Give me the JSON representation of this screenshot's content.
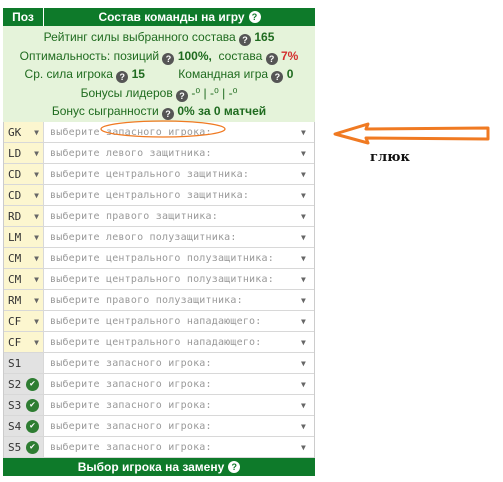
{
  "header": {
    "poz": "Поз",
    "title": "Состав команды на игру"
  },
  "stats": {
    "rating_label": "Рейтинг силы выбранного состава",
    "rating_value": "165",
    "optim_label": "Оптимальность: позиций",
    "optim_pos_value": "100%,",
    "optim_comp_label": "состава",
    "optim_comp_value": "7%",
    "avg_label": "Ср. сила игрока",
    "avg_value": "15",
    "team_label": "Командная игра",
    "team_value": "0",
    "leader_label": "Бонусы лидеров",
    "leader_value": "-⁰ | -⁰ | -⁰",
    "cohesion_label": "Бонус сыгранности",
    "cohesion_value": "0% за 0 матчей"
  },
  "rows": [
    {
      "pos": "GK",
      "placeholder": "выберите запасного игрока:",
      "type": "main"
    },
    {
      "pos": "LD",
      "placeholder": "выберите левого защитника:",
      "type": "main"
    },
    {
      "pos": "CD",
      "placeholder": "выберите центрального защитника:",
      "type": "main"
    },
    {
      "pos": "CD",
      "placeholder": "выберите центрального защитника:",
      "type": "main"
    },
    {
      "pos": "RD",
      "placeholder": "выберите правого защитника:",
      "type": "main"
    },
    {
      "pos": "LM",
      "placeholder": "выберите левого полузащитника:",
      "type": "main"
    },
    {
      "pos": "CM",
      "placeholder": "выберите центрального полузащитника:",
      "type": "main"
    },
    {
      "pos": "CM",
      "placeholder": "выберите центрального полузащитника:",
      "type": "main"
    },
    {
      "pos": "RM",
      "placeholder": "выберите правого полузащитника:",
      "type": "main"
    },
    {
      "pos": "CF",
      "placeholder": "выберите центрального нападающего:",
      "type": "main"
    },
    {
      "pos": "CF",
      "placeholder": "выберите центрального нападающего:",
      "type": "main"
    },
    {
      "pos": "S1",
      "placeholder": "выберите запасного игрока:",
      "type": "sub",
      "check": false
    },
    {
      "pos": "S2",
      "placeholder": "выберите запасного игрока:",
      "type": "sub",
      "check": true
    },
    {
      "pos": "S3",
      "placeholder": "выберите запасного игрока:",
      "type": "sub",
      "check": true
    },
    {
      "pos": "S4",
      "placeholder": "выберите запасного игрока:",
      "type": "sub",
      "check": true
    },
    {
      "pos": "S5",
      "placeholder": "выберите запасного игрока:",
      "type": "sub",
      "check": true
    }
  ],
  "footer": {
    "title": "Выбор игрока на замену"
  },
  "annotation": {
    "note": "глюк"
  },
  "icons": {
    "help": "question-circle-icon",
    "dropdown": "caret-down-icon",
    "check": "check-circle-icon"
  },
  "colors": {
    "header_green": "#0e7a2a",
    "stats_bg": "#e5f3da",
    "main_pos_bg": "#fcf6cf",
    "sub_pos_bg": "#e2e2e2",
    "annotation_orange": "#f07a22"
  }
}
